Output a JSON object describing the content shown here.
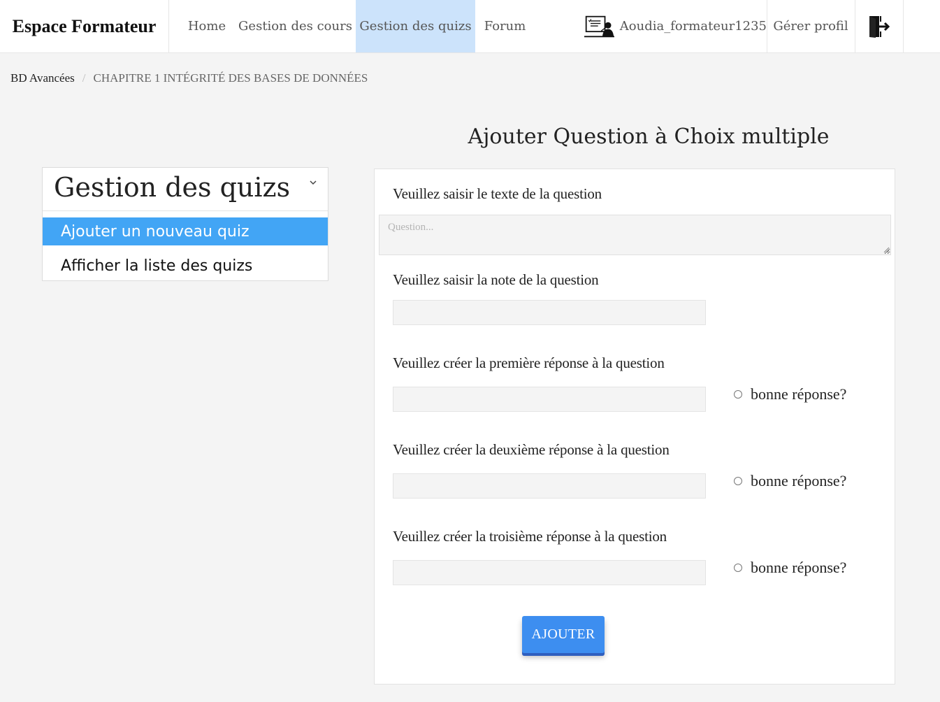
{
  "header": {
    "brand": "Espace Formateur",
    "nav": [
      {
        "label": "Home"
      },
      {
        "label": "Gestion des cours"
      },
      {
        "label": "Gestion des quizs",
        "active": true
      },
      {
        "label": "Forum"
      }
    ],
    "username": "Aoudia_formateur1235",
    "profile_label": "Gérer profil",
    "active_color": "#cce3fb",
    "icons": {
      "user": "teacher-board-icon",
      "logout": "logout-door-icon"
    }
  },
  "breadcrumb": {
    "items": [
      "BD Avancées",
      "CHAPITRE 1 INTÉGRITÉ DES BASES DE DONNÉES"
    ],
    "separator": "/"
  },
  "page_title": "Ajouter Question à Choix multiple",
  "sidebar": {
    "title": "Gestion des quizs",
    "items": [
      {
        "label": "Ajouter un nouveau quiz",
        "active": true
      },
      {
        "label": "Afficher la liste des quizs",
        "active": false
      }
    ],
    "active_color": "#42a5f5"
  },
  "form": {
    "question_label": "Veuillez saisir le texte de la question",
    "question_placeholder": "Question...",
    "question_value": "",
    "note_label": "Veuillez saisir la note de la question",
    "note_value": "",
    "answers": [
      {
        "label": "Veuillez créer la première réponse à la question",
        "value": "",
        "radio_label": "bonne réponse?",
        "checked": false
      },
      {
        "label": "Veuillez créer la deuxième réponse à la question",
        "value": "",
        "radio_label": "bonne réponse?",
        "checked": false
      },
      {
        "label": "Veuillez créer la troisième réponse à la question",
        "value": "",
        "radio_label": "bonne réponse?",
        "checked": false
      }
    ],
    "submit_label": "AJOUTER",
    "submit_color": "#3d8ef0"
  }
}
